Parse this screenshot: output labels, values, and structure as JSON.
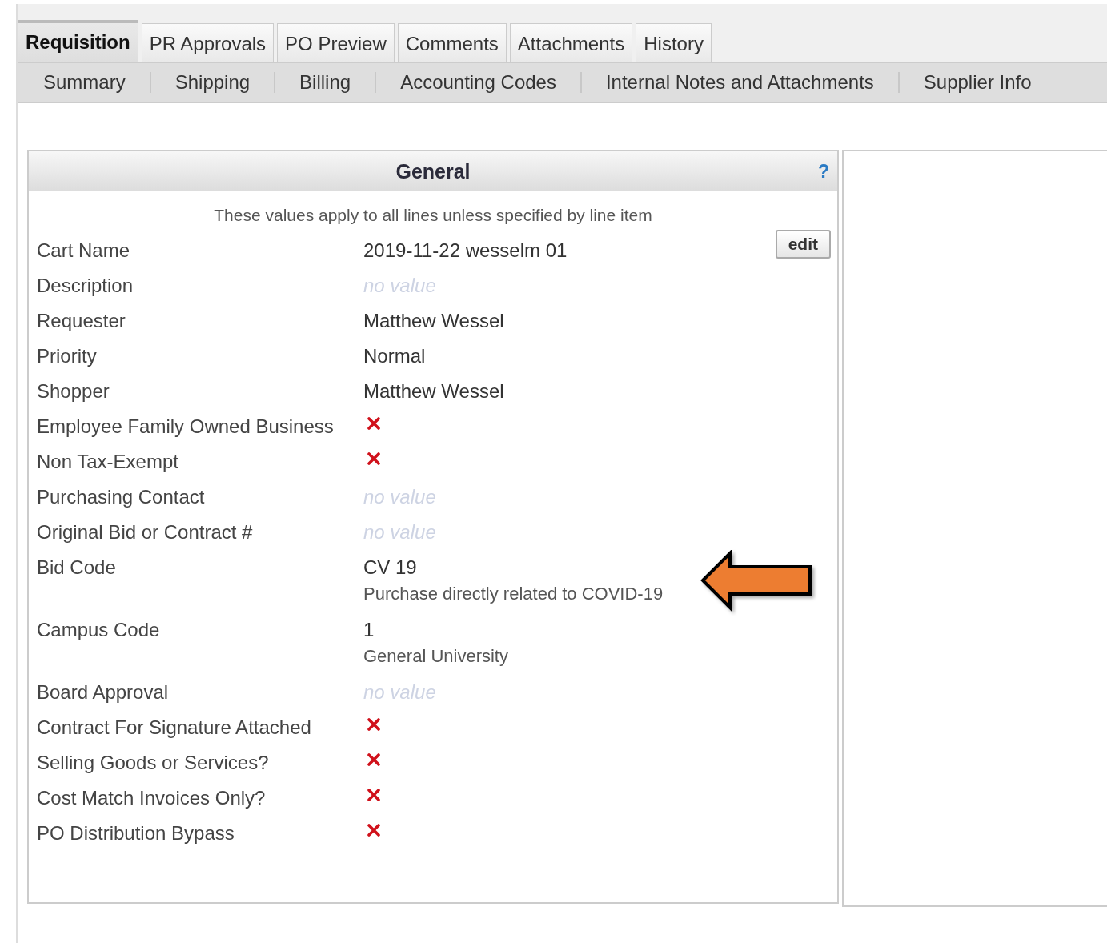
{
  "tabs": [
    {
      "label": "Requisition",
      "selected": true
    },
    {
      "label": "PR Approvals",
      "selected": false
    },
    {
      "label": "PO Preview",
      "selected": false
    },
    {
      "label": "Comments",
      "selected": false
    },
    {
      "label": "Attachments",
      "selected": false
    },
    {
      "label": "History",
      "selected": false
    }
  ],
  "subtabs": [
    "Summary",
    "Shipping",
    "Billing",
    "Accounting Codes",
    "Internal Notes and Attachments",
    "Supplier Info"
  ],
  "panel": {
    "title": "General",
    "help": "?",
    "note": "These values apply to all lines unless specified by line item",
    "edit_button": "edit",
    "fields": [
      {
        "label": "Cart Name",
        "kind": "text",
        "value": "2019-11-22 wesselm 01"
      },
      {
        "label": "Description",
        "kind": "empty",
        "value": "no value"
      },
      {
        "label": "Requester",
        "kind": "text",
        "value": "Matthew Wessel"
      },
      {
        "label": "Priority",
        "kind": "text",
        "value": "Normal"
      },
      {
        "label": "Shopper",
        "kind": "text",
        "value": "Matthew Wessel"
      },
      {
        "label": "Employee Family Owned Business",
        "kind": "no"
      },
      {
        "label": "Non Tax-Exempt",
        "kind": "no"
      },
      {
        "label": "Purchasing Contact",
        "kind": "empty",
        "value": "no value"
      },
      {
        "label": "Original Bid or Contract #",
        "kind": "empty",
        "value": "no value"
      },
      {
        "label": "Bid Code",
        "kind": "text",
        "value": "CV 19",
        "detail": "Purchase directly related to COVID-19",
        "highlighted": true
      },
      {
        "label": "Campus Code",
        "kind": "text",
        "value": "1",
        "detail": "General University"
      },
      {
        "label": "Board Approval",
        "kind": "empty",
        "value": "no value"
      },
      {
        "label": "Contract For Signature Attached",
        "kind": "no"
      },
      {
        "label": "Selling Goods or Services?",
        "kind": "no"
      },
      {
        "label": "Cost Match Invoices Only?",
        "kind": "no"
      },
      {
        "label": "PO Distribution Bypass",
        "kind": "no"
      }
    ]
  }
}
